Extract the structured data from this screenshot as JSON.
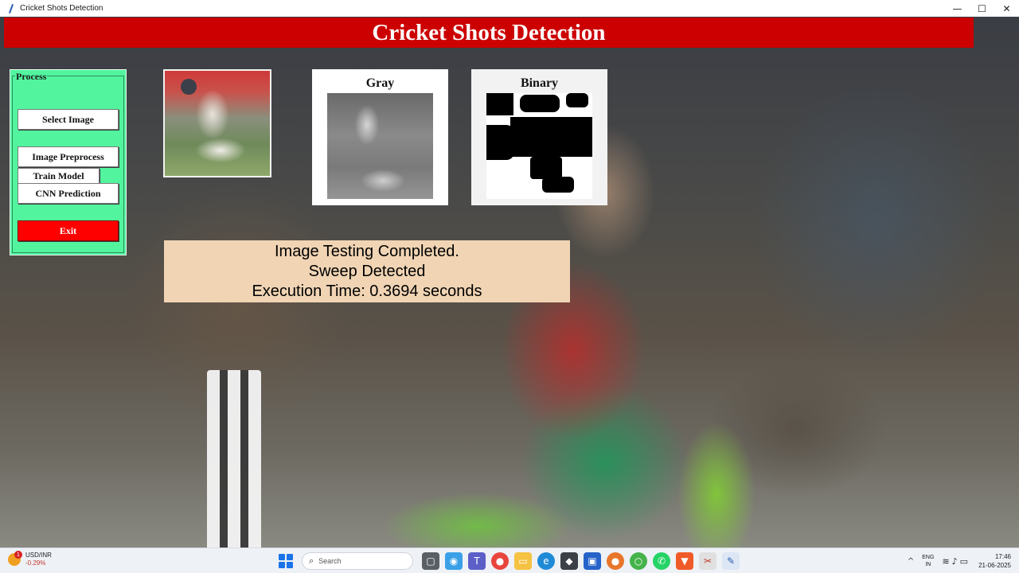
{
  "window": {
    "title": "Cricket Shots Detection",
    "minimize": "—",
    "maximize": "☐",
    "close": "✕"
  },
  "header": {
    "title": "Cricket Shots Detection"
  },
  "process": {
    "legend": "Process",
    "select_image": "Select Image",
    "image_preprocess": "Image Preprocess",
    "train_model": "Train Model",
    "cnn_prediction": "CNN Prediction",
    "exit": "Exit"
  },
  "images": {
    "gray_label": "Gray",
    "binary_label": "Binary"
  },
  "result": {
    "line1": "Image Testing Completed.",
    "line2": "Sweep Detected",
    "line3": "Execution Time: 0.3694 seconds"
  },
  "colors": {
    "header_bg": "#cc0000",
    "panel_bg": "#52f59e",
    "exit_bg": "#ff0000",
    "result_bg": "#f0d4b4"
  },
  "taskbar": {
    "stock_pair": "USD/INR",
    "stock_change": "-0.29%",
    "stock_badge": "1",
    "search_placeholder": "Search",
    "lang_top": "ENG",
    "lang_bottom": "IN",
    "time": "17:46",
    "date": "21-06-2025",
    "apps": [
      "task-view-icon",
      "copilot-icon",
      "teams-icon",
      "chrome-icon",
      "file-explorer-icon",
      "edge-icon",
      "terminal-icon",
      "store-icon",
      "firefox-icon",
      "app-icon",
      "whatsapp-icon",
      "brave-icon",
      "snip-icon",
      "python-icon"
    ]
  }
}
